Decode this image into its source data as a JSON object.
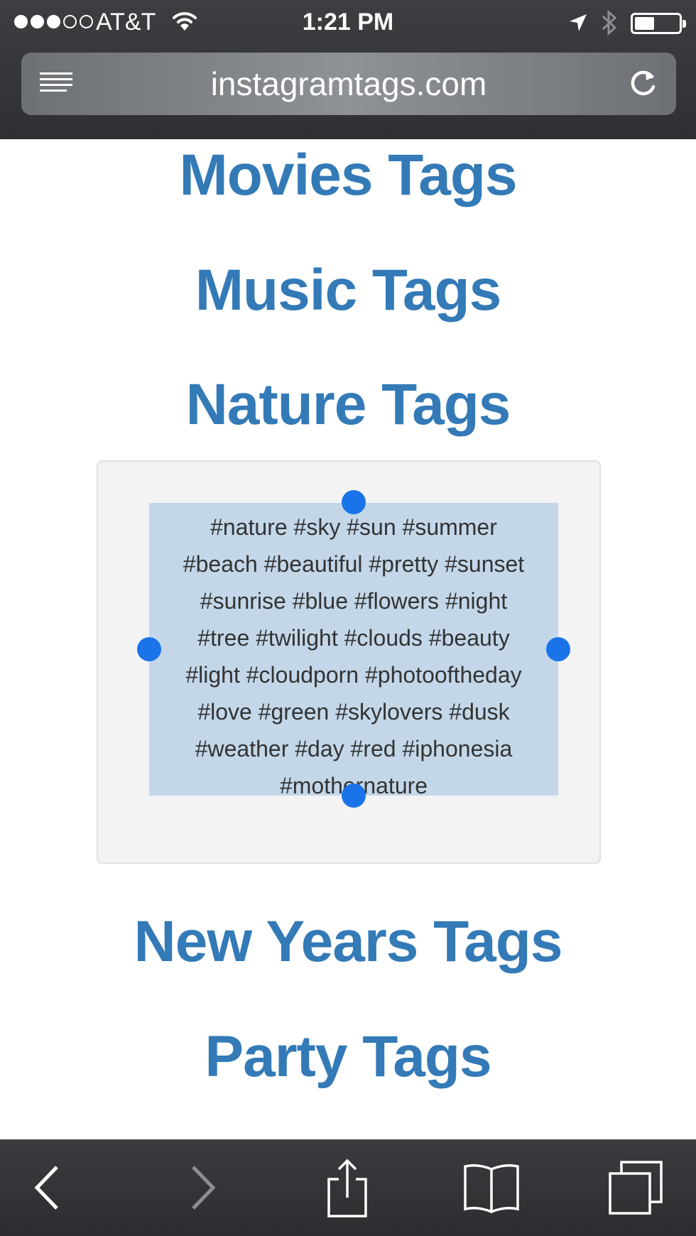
{
  "status_bar": {
    "carrier": "AT&T",
    "time": "1:21 PM",
    "signal_bars_filled": 3,
    "signal_bars_total": 5,
    "battery_level": 0.45,
    "icons": [
      "wifi-icon",
      "location-arrow-icon",
      "bluetooth-icon",
      "battery-icon"
    ]
  },
  "address_bar": {
    "url": "instagramtags.com",
    "icons": [
      "reader-list-icon",
      "reload-icon"
    ]
  },
  "page": {
    "headings_above": [
      {
        "label": "Movies Tags"
      },
      {
        "label": "Music Tags"
      },
      {
        "label": "Nature Tags"
      }
    ],
    "tag_box": {
      "lines": [
        "#nature #sky #sun #summer",
        "#beach #beautiful #pretty #sunset",
        "#sunrise #blue #flowers #night",
        "#tree #twilight #clouds #beauty",
        "#light #cloudporn #photooftheday",
        "#love #green #skylovers #dusk",
        "#weather #day #red #iphonesia",
        "#mothernature"
      ],
      "selected": true
    },
    "headings_below": [
      {
        "label": "New Years Tags"
      },
      {
        "label": "Party Tags"
      }
    ]
  },
  "toolbar": {
    "buttons": [
      "back-icon",
      "forward-icon",
      "share-icon",
      "bookmarks-icon",
      "tabs-icon"
    ]
  },
  "colors": {
    "heading": "#337ab7",
    "selection": "#c3d7e9",
    "handle": "#1a73e8",
    "chrome": "#2e3033"
  }
}
